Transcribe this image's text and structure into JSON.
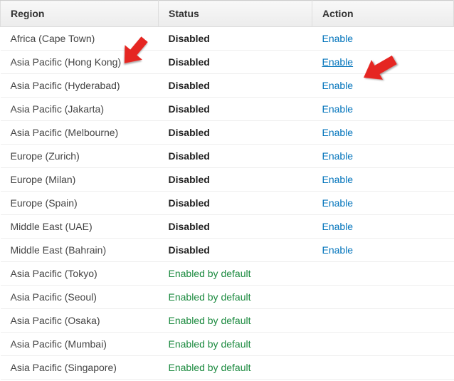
{
  "headers": {
    "region": "Region",
    "status": "Status",
    "action": "Action"
  },
  "status_labels": {
    "disabled": "Disabled",
    "enabled_default": "Enabled by default"
  },
  "action_labels": {
    "enable": "Enable"
  },
  "rows": [
    {
      "region": "Africa (Cape Town)",
      "status": "disabled",
      "action": "enable",
      "highlight": false
    },
    {
      "region": "Asia Pacific (Hong Kong)",
      "status": "disabled",
      "action": "enable",
      "highlight": true
    },
    {
      "region": "Asia Pacific (Hyderabad)",
      "status": "disabled",
      "action": "enable",
      "highlight": false
    },
    {
      "region": "Asia Pacific (Jakarta)",
      "status": "disabled",
      "action": "enable",
      "highlight": false
    },
    {
      "region": "Asia Pacific (Melbourne)",
      "status": "disabled",
      "action": "enable",
      "highlight": false
    },
    {
      "region": "Europe (Zurich)",
      "status": "disabled",
      "action": "enable",
      "highlight": false
    },
    {
      "region": "Europe (Milan)",
      "status": "disabled",
      "action": "enable",
      "highlight": false
    },
    {
      "region": "Europe (Spain)",
      "status": "disabled",
      "action": "enable",
      "highlight": false
    },
    {
      "region": "Middle East (UAE)",
      "status": "disabled",
      "action": "enable",
      "highlight": false
    },
    {
      "region": "Middle East (Bahrain)",
      "status": "disabled",
      "action": "enable",
      "highlight": false
    },
    {
      "region": "Asia Pacific (Tokyo)",
      "status": "enabled_default",
      "action": null,
      "highlight": false
    },
    {
      "region": "Asia Pacific (Seoul)",
      "status": "enabled_default",
      "action": null,
      "highlight": false
    },
    {
      "region": "Asia Pacific (Osaka)",
      "status": "enabled_default",
      "action": null,
      "highlight": false
    },
    {
      "region": "Asia Pacific (Mumbai)",
      "status": "enabled_default",
      "action": null,
      "highlight": false
    },
    {
      "region": "Asia Pacific (Singapore)",
      "status": "enabled_default",
      "action": null,
      "highlight": false
    }
  ]
}
